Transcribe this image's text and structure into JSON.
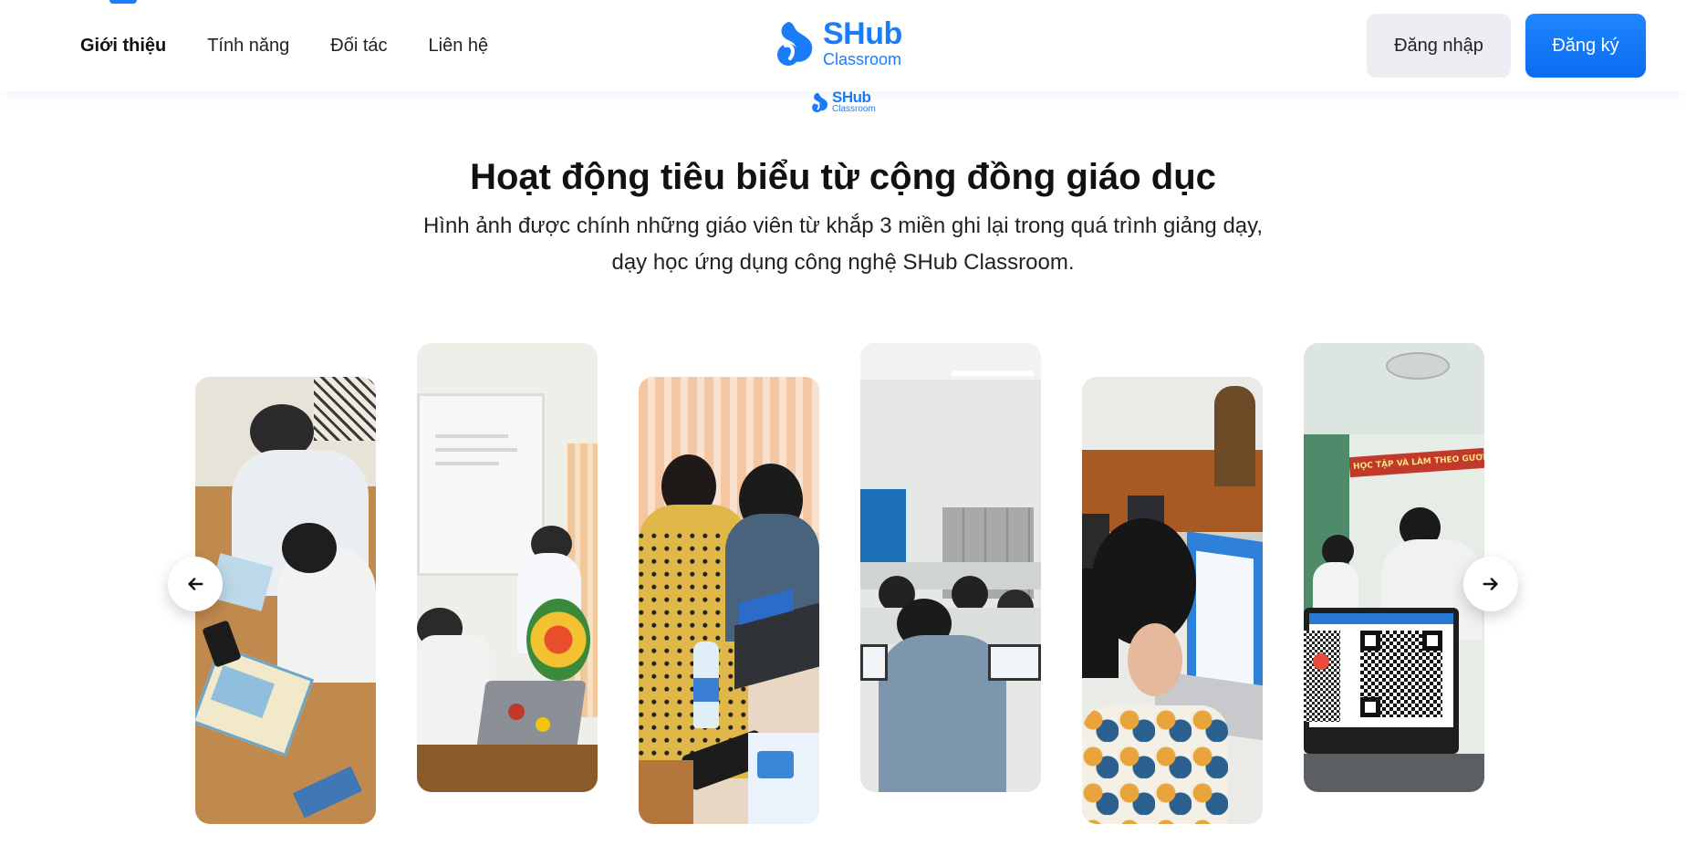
{
  "header": {
    "nav": [
      {
        "label": "Giới thiệu",
        "active": true
      },
      {
        "label": "Tính năng",
        "active": false
      },
      {
        "label": "Đối tác",
        "active": false
      },
      {
        "label": "Liên hệ",
        "active": false
      }
    ],
    "logo": {
      "main": "SHub",
      "sub": "Classroom"
    },
    "login_label": "Đăng nhập",
    "register_label": "Đăng ký"
  },
  "mini_logo": {
    "main": "SHub",
    "sub": "Classroom"
  },
  "section": {
    "title": "Hoạt động tiêu biểu từ cộng đồng giáo dục",
    "description": "Hình ảnh được chính những giáo viên từ khắp 3 miền ghi lại trong quá trình giảng dạy, dạy học ứng dụng công nghệ SHub Classroom."
  },
  "gallery": {
    "photos": [
      {
        "subject": "students-with-map-photo"
      },
      {
        "subject": "presentation-projector-photo"
      },
      {
        "subject": "teacher-with-laptop-photo"
      },
      {
        "subject": "computer-lab-photo"
      },
      {
        "subject": "student-laptop-photo"
      },
      {
        "subject": "qr-code-classroom-photo",
        "banner_text": "HỌC TẬP VÀ LÀM THEO GƯƠNG BÁC"
      }
    ],
    "prev_icon": "arrow-left-icon",
    "next_icon": "arrow-right-icon"
  },
  "colors": {
    "brand": "#1a7cf7",
    "login_bg": "#eceef3",
    "text": "#111111"
  }
}
